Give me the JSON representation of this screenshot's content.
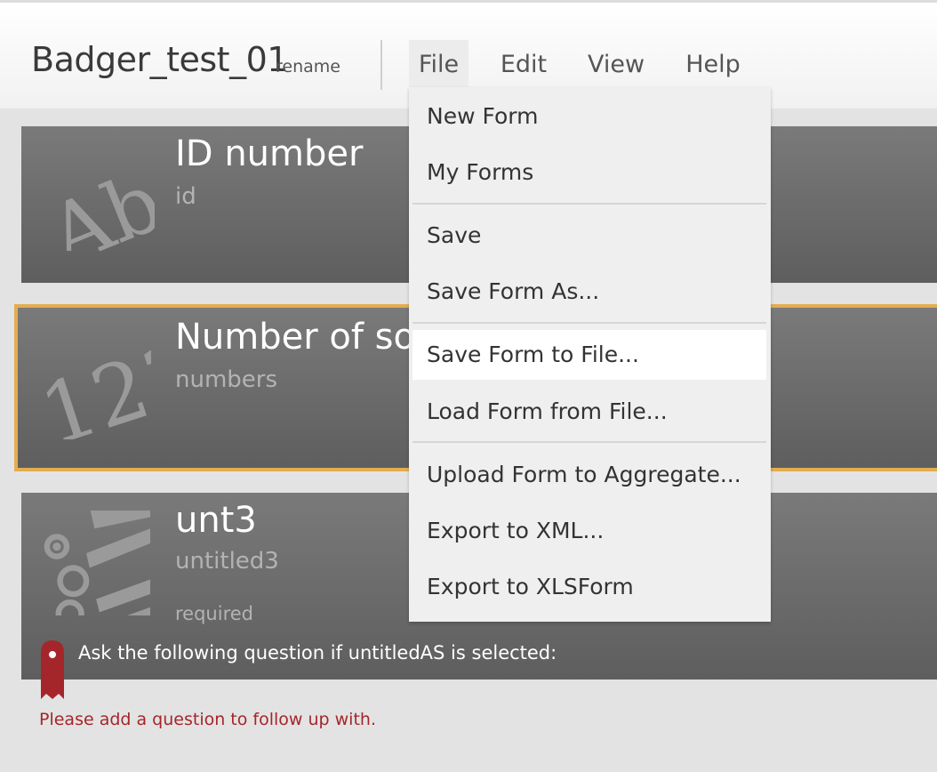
{
  "header": {
    "form_title": "Badger_test_01",
    "rename_label": "rename",
    "menus": [
      "File",
      "Edit",
      "View",
      "Help"
    ]
  },
  "file_menu": {
    "items": [
      "New Form",
      "My Forms",
      "Save",
      "Save Form As...",
      "Save Form to File...",
      "Load Form from File...",
      "Upload Form to Aggregate...",
      "Export to XML...",
      "Export to XLSForm"
    ],
    "highlighted_item": "Save Form to File..."
  },
  "questions": [
    {
      "title": "ID number",
      "name": "id",
      "icon": "text-abc-icon"
    },
    {
      "title": "Number of som",
      "name": "numbers",
      "icon": "number-123-icon",
      "selected": true
    },
    {
      "title": "unt3",
      "name": "untitled3",
      "icon": "select-options-icon",
      "required_label": "required",
      "skip_logic_text": "Ask the following question if untitledAS is selected:"
    }
  ],
  "followup_warning": "Please add a question to follow up with.",
  "colors": {
    "selection_outline": "#e3ad4f",
    "warning_text": "#a5262a",
    "bookmark": "#a5262a"
  }
}
